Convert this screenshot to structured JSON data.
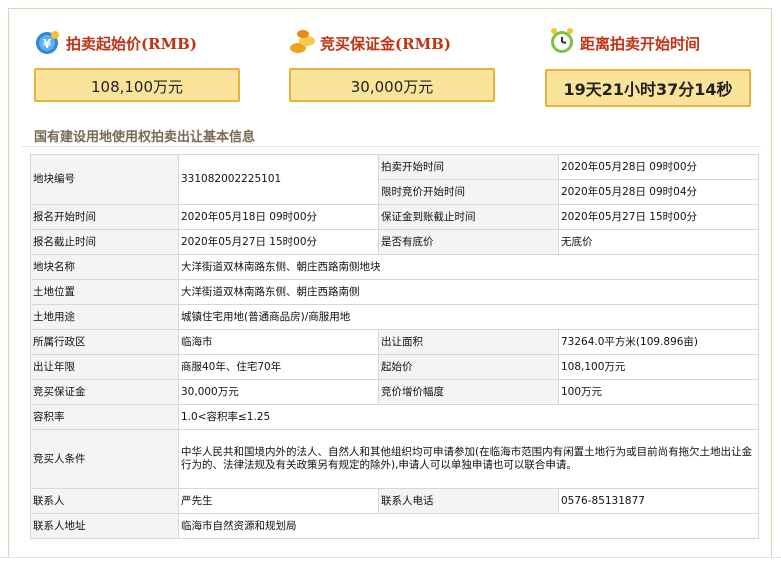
{
  "kpis": {
    "start_price": {
      "label": "拍卖起始价(RMB)",
      "value": "108,100万元",
      "icon": "money-bag-icon"
    },
    "deposit": {
      "label": "竞买保证金(RMB)",
      "value": "30,000万元",
      "icon": "coins-icon"
    },
    "countdown": {
      "label": "距离拍卖开始时间",
      "value": "19天21小时37分14秒",
      "icon": "alarm-clock-icon"
    }
  },
  "section_title": "国有建设用地使用权拍卖出让基本信息",
  "rows": {
    "parcel_no": {
      "label": "地块编号",
      "value": "331082002225101"
    },
    "auction_start": {
      "label": "拍卖开始时间",
      "value": "2020年05月28日 09时00分"
    },
    "timed_bid_start": {
      "label": "限时竞价开始时间",
      "value": "2020年05月28日 09时04分"
    },
    "reg_start": {
      "label": "报名开始时间",
      "value": "2020年05月18日 09时00分"
    },
    "deposit_deadline": {
      "label": "保证金到账截止时间",
      "value": "2020年05月27日 15时00分"
    },
    "reg_deadline": {
      "label": "报名截止时间",
      "value": "2020年05月27日 15时00分"
    },
    "reserve": {
      "label": "是否有底价",
      "value": "无底价"
    },
    "parcel_name": {
      "label": "地块名称",
      "value": "大洋街道双林南路东侧、朝庄西路南侧地块"
    },
    "location": {
      "label": "土地位置",
      "value": "大洋街道双林南路东侧、朝庄西路南侧"
    },
    "usage": {
      "label": "土地用途",
      "value": "城镇住宅用地(普通商品房)/商服用地"
    },
    "district": {
      "label": "所属行政区",
      "value": "临海市"
    },
    "area": {
      "label": "出让面积",
      "value": "73264.0平方米(109.896亩)"
    },
    "term": {
      "label": "出让年限",
      "value": "商服40年、住宅70年"
    },
    "start_price": {
      "label": "起始价",
      "value": "108,100万元"
    },
    "deposit": {
      "label": "竞买保证金",
      "value": "30,000万元"
    },
    "increment": {
      "label": "竞价增价幅度",
      "value": "100万元"
    },
    "far": {
      "label": "容积率",
      "value": "1.0<容积率≤1.25"
    },
    "conditions": {
      "label": "竞买人条件",
      "value": "中华人民共和国境内外的法人、自然人和其他组织均可申请参加(在临海市范围内有闲置土地行为或目前尚有拖欠土地出让金行为的、法律法规及有关政策另有规定的除外),申请人可以单独申请也可以联合申请。"
    },
    "contact": {
      "label": "联系人",
      "value": "严先生"
    },
    "phone": {
      "label": "联系人电话",
      "value": "0576-85131877"
    },
    "address": {
      "label": "联系人地址",
      "value": "临海市自然资源和规划局"
    }
  },
  "colors": {
    "accent": "#c03313",
    "kpi_fill": "#fbe39c",
    "kpi_border": "#e9b23f"
  }
}
